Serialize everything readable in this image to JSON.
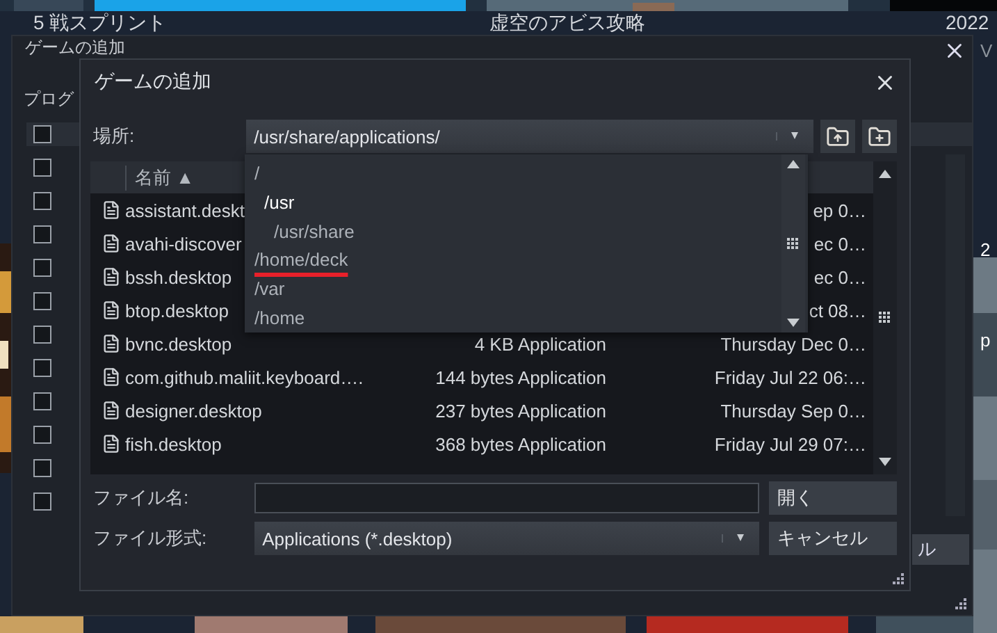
{
  "background": {
    "titles": [
      "5 戦スプリント",
      "虚空のアビス攻略",
      "2022"
    ],
    "edge_texts": [
      "V",
      "2",
      "p"
    ]
  },
  "outer_dialog": {
    "title": "ゲームの追加",
    "section_label": "プログ",
    "checkboxes": [
      false,
      false,
      false,
      false,
      false,
      false,
      false,
      false,
      false,
      false,
      false,
      false
    ],
    "button": "ル"
  },
  "dialog": {
    "title": "ゲームの追加",
    "location_label": "場所:",
    "location": "/usr/share/applications/",
    "popup": [
      {
        "label": "/",
        "current": false,
        "underlined": false,
        "children": [
          {
            "label": "/usr",
            "current": true,
            "underlined": false,
            "children": [
              {
                "label": "/usr/share",
                "current": false,
                "underlined": false
              }
            ]
          }
        ]
      },
      {
        "label": "/home/deck",
        "current": false,
        "underlined": true
      },
      {
        "label": "/var",
        "current": false,
        "underlined": false
      },
      {
        "label": "/home",
        "current": false,
        "underlined": false
      }
    ],
    "columns": [
      "名前 ▲"
    ],
    "rows": [
      {
        "name": "assistant.deskt",
        "date": "ep 0…"
      },
      {
        "name": "avahi-discover",
        "date": "ec 0…"
      },
      {
        "name": "bssh.desktop",
        "date": "ec 0…"
      },
      {
        "name": "btop.desktop",
        "date": "ct 08…"
      },
      {
        "name": "bvnc.desktop",
        "size": "4 KB Application",
        "date": "Thursday Dec 0…"
      },
      {
        "name": "com.github.maliit.keyboard….",
        "size": "144 bytes Application",
        "date": "Friday Jul 22 06:…"
      },
      {
        "name": "designer.desktop",
        "size": "237 bytes Application",
        "date": "Thursday Sep 0…"
      },
      {
        "name": "fish.desktop",
        "size": "368 bytes Application",
        "date": "Friday Jul 29 07:…"
      }
    ],
    "filename_label": "ファイル名:",
    "filetype_label": "ファイル形式:",
    "filetype": "Applications (*.desktop)",
    "open_button": "開く",
    "cancel_button": "キャンセル"
  }
}
